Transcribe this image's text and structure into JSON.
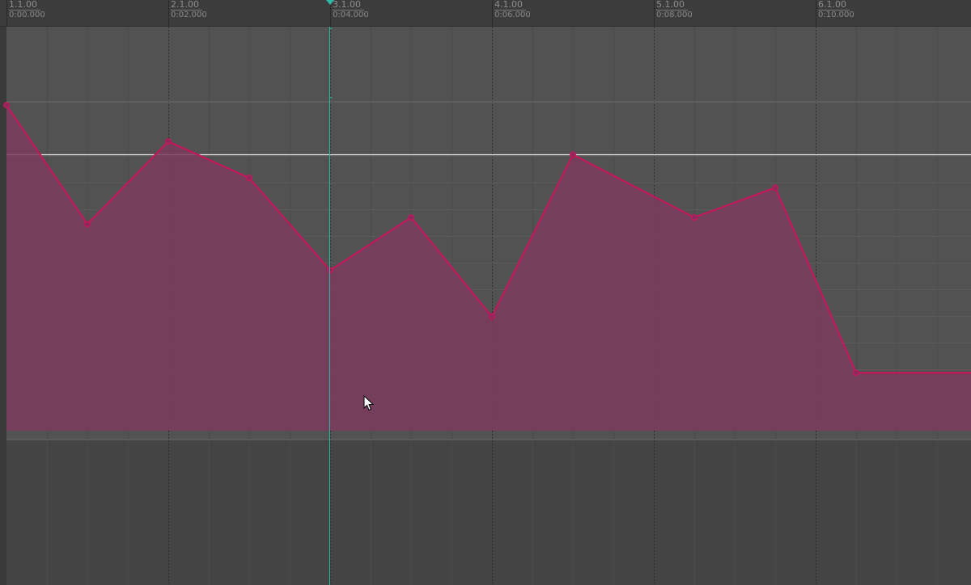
{
  "ruler": {
    "marks": [
      {
        "bar": "1.1.00",
        "time": "0:00.000"
      },
      {
        "bar": "2.1.00",
        "time": "0:02.000"
      },
      {
        "bar": "3.1.00",
        "time": "0:04.000"
      },
      {
        "bar": "4.1.00",
        "time": "0:06.000"
      },
      {
        "bar": "5.1.00",
        "time": "0:08.000"
      },
      {
        "bar": "6.1.00",
        "time": "0:10.000"
      }
    ]
  },
  "automation": {
    "color": "#c2185b",
    "fill_color": "#7a3b5e",
    "playhead_color": "#2fb8a8",
    "points_time_seconds": [
      0.0,
      1.0,
      2.0,
      3.0,
      4.0,
      5.0,
      6.0,
      7.0,
      8.5,
      9.5,
      10.5,
      12.0
    ],
    "points_level": [
      0.99,
      0.63,
      0.88,
      0.77,
      0.49,
      0.65,
      0.35,
      0.84,
      0.65,
      0.74,
      0.18,
      0.18
    ]
  },
  "playhead": {
    "time_seconds": 4.0
  },
  "icons": {
    "playhead_marker": "playhead-marker-icon",
    "mouse_cursor": "mouse-pointer-icon"
  }
}
